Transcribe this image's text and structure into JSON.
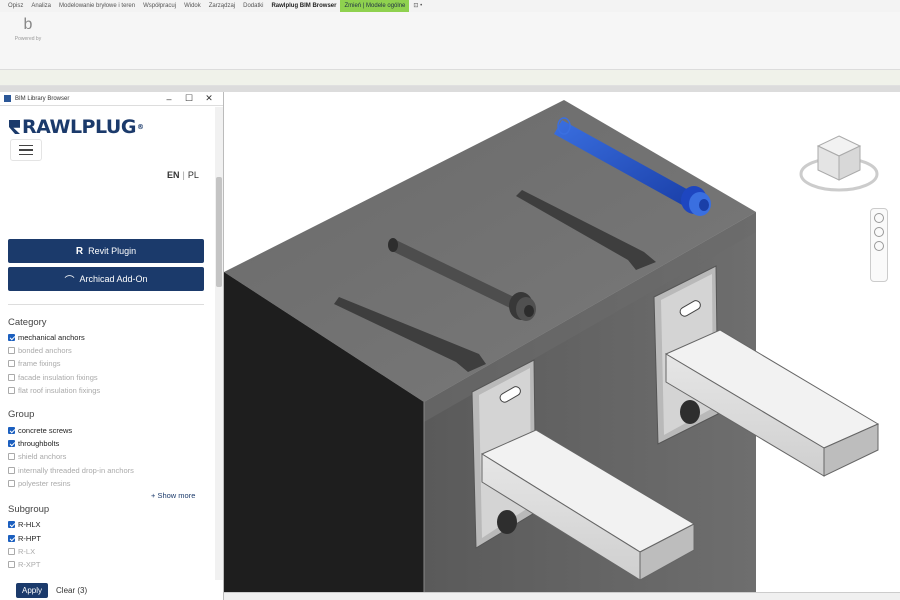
{
  "ribbon": {
    "tabs": [
      "Opisz",
      "Analiza",
      "Modelowanie bryłowe i teren",
      "Współpracuj",
      "Widok",
      "Zarządzaj",
      "Dodatki",
      "Rawlplug BIM Browser",
      "Zmień | Modele ogólne",
      "⊡ •"
    ],
    "active_tab_index": 7,
    "highlight_tab_index": 8,
    "plugin_caption": "Powered by"
  },
  "panel": {
    "title": "BIM Library Browser",
    "window_buttons": [
      "–",
      "☐",
      "✕"
    ],
    "logo_text": "RAWLPLUG",
    "logo_reg": "®",
    "lang": {
      "en": "EN",
      "sep": "|",
      "pl": "PL"
    },
    "revit_button": "Revit Plugin",
    "archicad_button": "Archicad Add-On",
    "accent_color": "#1b3a6b"
  },
  "filters": {
    "category": {
      "title": "Category",
      "items": [
        {
          "label": "mechanical anchors",
          "checked": true
        },
        {
          "label": "bonded anchors",
          "checked": false
        },
        {
          "label": "frame fixings",
          "checked": false
        },
        {
          "label": "facade insulation fixings",
          "checked": false
        },
        {
          "label": "flat roof insulation fixings",
          "checked": false
        }
      ]
    },
    "group": {
      "title": "Group",
      "items": [
        {
          "label": "concrete screws",
          "checked": true
        },
        {
          "label": "throughbolts",
          "checked": true
        },
        {
          "label": "shield anchors",
          "checked": false
        },
        {
          "label": "internally threaded drop-in anchors",
          "checked": false
        },
        {
          "label": "polyester resins",
          "checked": false
        }
      ],
      "show_more": "+ Show more"
    },
    "subgroup": {
      "title": "Subgroup",
      "items": [
        {
          "label": "R-HLX",
          "checked": true
        },
        {
          "label": "R-HPT",
          "checked": true
        },
        {
          "label": "R-LX",
          "checked": false
        },
        {
          "label": "R-XPT",
          "checked": false
        }
      ]
    }
  },
  "actions": {
    "apply": "Apply",
    "clear": "Clear (3)"
  }
}
